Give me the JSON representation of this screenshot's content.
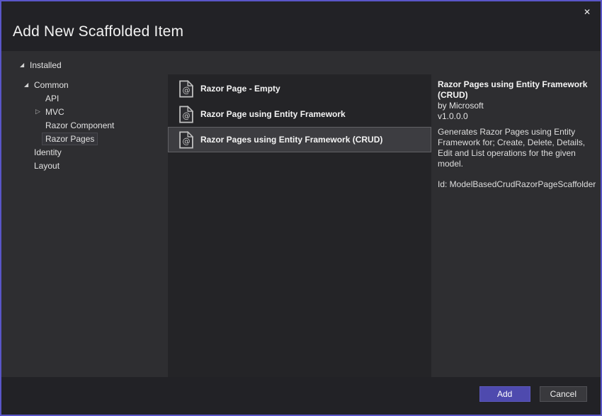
{
  "window": {
    "title": "Add New Scaffolded Item",
    "close_icon": "✕",
    "border_color": "#5a56c8",
    "accent_color": "#4e4aae"
  },
  "glyphs": {
    "expanded": "◢",
    "collapsed": "▷"
  },
  "tree": {
    "items": [
      {
        "label": "Installed",
        "level": 0,
        "state": "expanded",
        "selected": false
      },
      {
        "label": "Common",
        "level": 1,
        "state": "expanded",
        "selected": false
      },
      {
        "label": "API",
        "level": 2,
        "state": "none",
        "selected": false
      },
      {
        "label": "MVC",
        "level": 2,
        "state": "collapsed",
        "selected": false
      },
      {
        "label": "Razor Component",
        "level": 2,
        "state": "none",
        "selected": false
      },
      {
        "label": "Razor Pages",
        "level": 2,
        "state": "none",
        "selected": true
      },
      {
        "label": "Identity",
        "level": 1,
        "state": "none",
        "selected": false
      },
      {
        "label": "Layout",
        "level": 1,
        "state": "none",
        "selected": false
      }
    ]
  },
  "list": {
    "icon_glyph": "@",
    "items": [
      {
        "label": "Razor Page - Empty",
        "selected": false
      },
      {
        "label": "Razor Page using Entity Framework",
        "selected": false
      },
      {
        "label": "Razor Pages using Entity Framework (CRUD)",
        "selected": true
      }
    ]
  },
  "details": {
    "title": "Razor Pages using Entity Framework (CRUD)",
    "author": "by Microsoft",
    "version": "v1.0.0.0",
    "description": "Generates Razor Pages using Entity Framework for; Create, Delete, Details, Edit and List operations for the given model.",
    "id_line": "Id: ModelBasedCrudRazorPageScaffolder"
  },
  "footer": {
    "add_label": "Add",
    "cancel_label": "Cancel"
  }
}
